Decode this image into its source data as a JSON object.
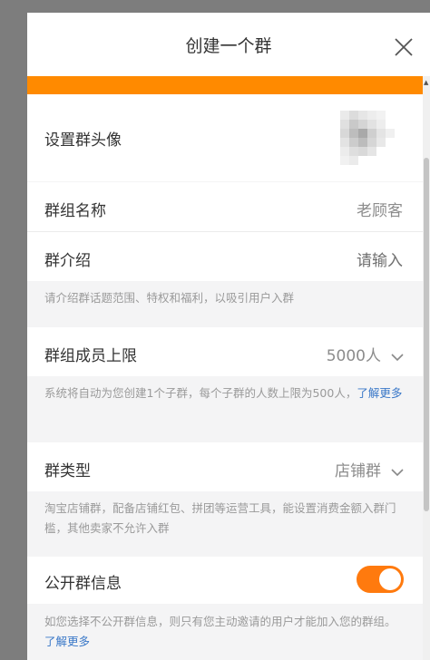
{
  "dialog": {
    "title": "创建一个群"
  },
  "avatar_row": {
    "label": "设置群头像",
    "icon": "pixelated-avatar"
  },
  "group_name": {
    "label": "群组名称",
    "value": "老顾客"
  },
  "group_intro": {
    "label": "群介绍",
    "value": "请输入",
    "hint": "请介绍群话题范围、特权和福利，以吸引用户入群"
  },
  "member_limit": {
    "label": "群组成员上限",
    "value": "5000人",
    "hint": "系统将自动为您创建1个子群，每个子群的人数上限为500人，",
    "hint_link": "了解更多"
  },
  "group_type": {
    "label": "群类型",
    "value": "店铺群",
    "hint": "淘宝店铺群，配备店铺红包、拼团等运营工具，能设置消费金额入群门槛，其他卖家不允许入群"
  },
  "public_info": {
    "label": "公开群信息",
    "enabled": true,
    "hint": "如您选择不公开群信息，则只有您主动邀请的用户才能加入您的群组。",
    "hint_link": "了解更多"
  },
  "colors": {
    "accent": "#ff8a00",
    "toggle_on": "#ff7a0e",
    "link": "#3a78c8"
  }
}
